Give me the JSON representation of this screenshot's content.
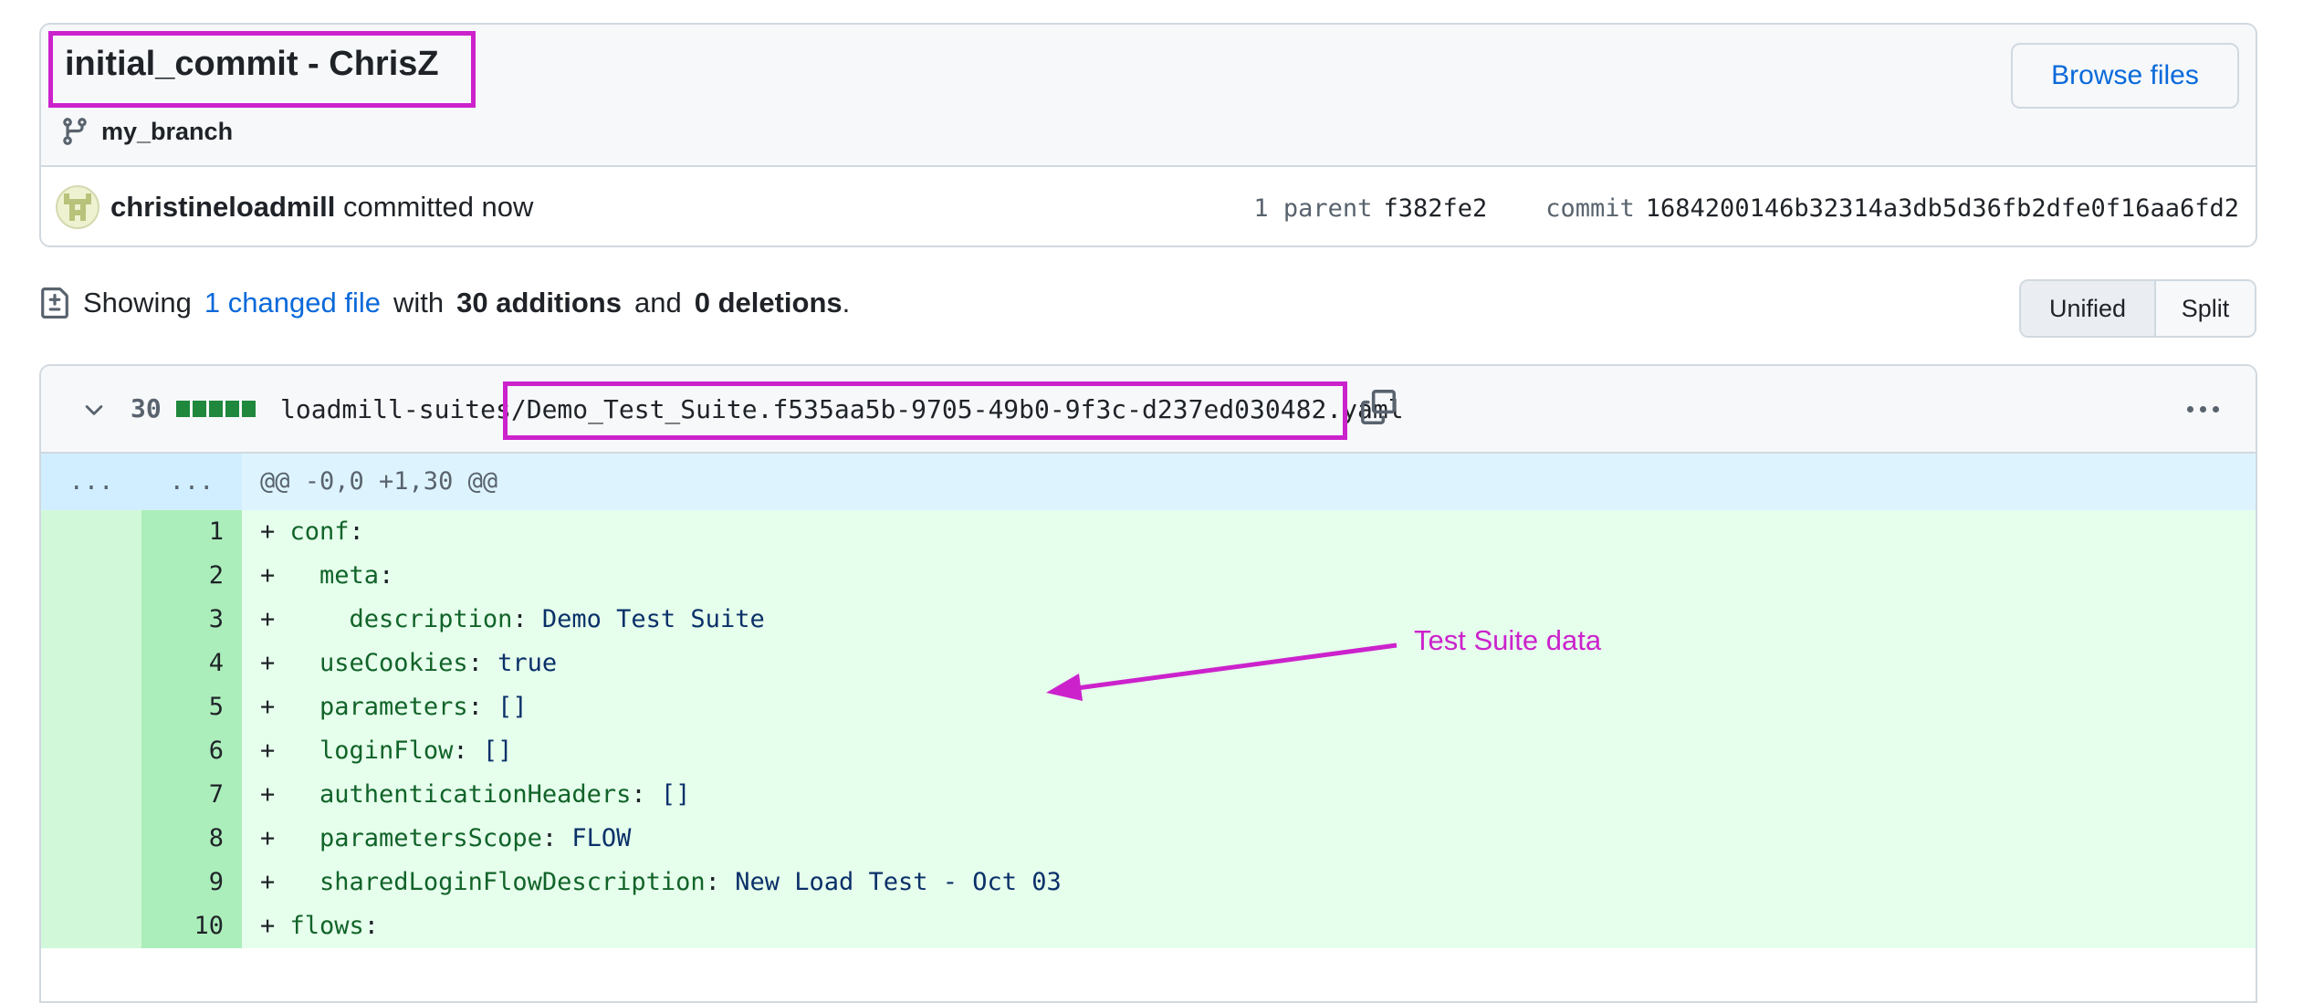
{
  "commit": {
    "title": "initial_commit - ChrisZ",
    "branch": "my_branch",
    "browse_label": "Browse files",
    "author": "christineloadmill",
    "author_suffix": " committed now",
    "parent_label": "1 parent",
    "parent_sha": "f382fe2",
    "commit_label": "commit",
    "commit_sha": "1684200146b32314a3db5d36fb2dfe0f16aa6fd2"
  },
  "summary": {
    "showing": "Showing",
    "changed_link": "1 changed file",
    "with": "with",
    "additions": "30 additions",
    "and": "and",
    "deletions": "0 deletions",
    "period": "."
  },
  "view_toggle": {
    "unified": "Unified",
    "split": "Split",
    "selected": "Unified"
  },
  "file": {
    "additions_count": "30",
    "dir": "loadmill-suites/",
    "name": "Demo_Test_Suite.f535aa5b-9705-49b0-9f3c-d237ed030482.yaml"
  },
  "hunk": {
    "old_gutter": "...",
    "new_gutter": "...",
    "header": "@@ -0,0 +1,30 @@"
  },
  "lines": [
    {
      "num": "1",
      "sign": "+ ",
      "indent": "",
      "key": "conf",
      "sep": ":",
      "value": ""
    },
    {
      "num": "2",
      "sign": "+ ",
      "indent": "  ",
      "key": "meta",
      "sep": ":",
      "value": ""
    },
    {
      "num": "3",
      "sign": "+ ",
      "indent": "    ",
      "key": "description",
      "sep": ": ",
      "value": "Demo Test Suite"
    },
    {
      "num": "4",
      "sign": "+ ",
      "indent": "  ",
      "key": "useCookies",
      "sep": ": ",
      "value": "true"
    },
    {
      "num": "5",
      "sign": "+ ",
      "indent": "  ",
      "key": "parameters",
      "sep": ": ",
      "value": "[]"
    },
    {
      "num": "6",
      "sign": "+ ",
      "indent": "  ",
      "key": "loginFlow",
      "sep": ": ",
      "value": "[]"
    },
    {
      "num": "7",
      "sign": "+ ",
      "indent": "  ",
      "key": "authenticationHeaders",
      "sep": ": ",
      "value": "[]"
    },
    {
      "num": "8",
      "sign": "+ ",
      "indent": "  ",
      "key": "parametersScope",
      "sep": ": ",
      "value": "FLOW"
    },
    {
      "num": "9",
      "sign": "+ ",
      "indent": "  ",
      "key": "sharedLoginFlowDescription",
      "sep": ": ",
      "value": "New Load Test - Oct 03"
    },
    {
      "num": "10",
      "sign": "+ ",
      "indent": "",
      "key": "flows",
      "sep": ":",
      "value": ""
    }
  ],
  "annotation": {
    "text": "Test Suite data",
    "color": "#cc22cc"
  },
  "colors": {
    "link": "#0969da",
    "addition_bg": "#e6ffec",
    "addition_gutter": "#aceebb",
    "hunk_bg": "#ddf4ff"
  }
}
